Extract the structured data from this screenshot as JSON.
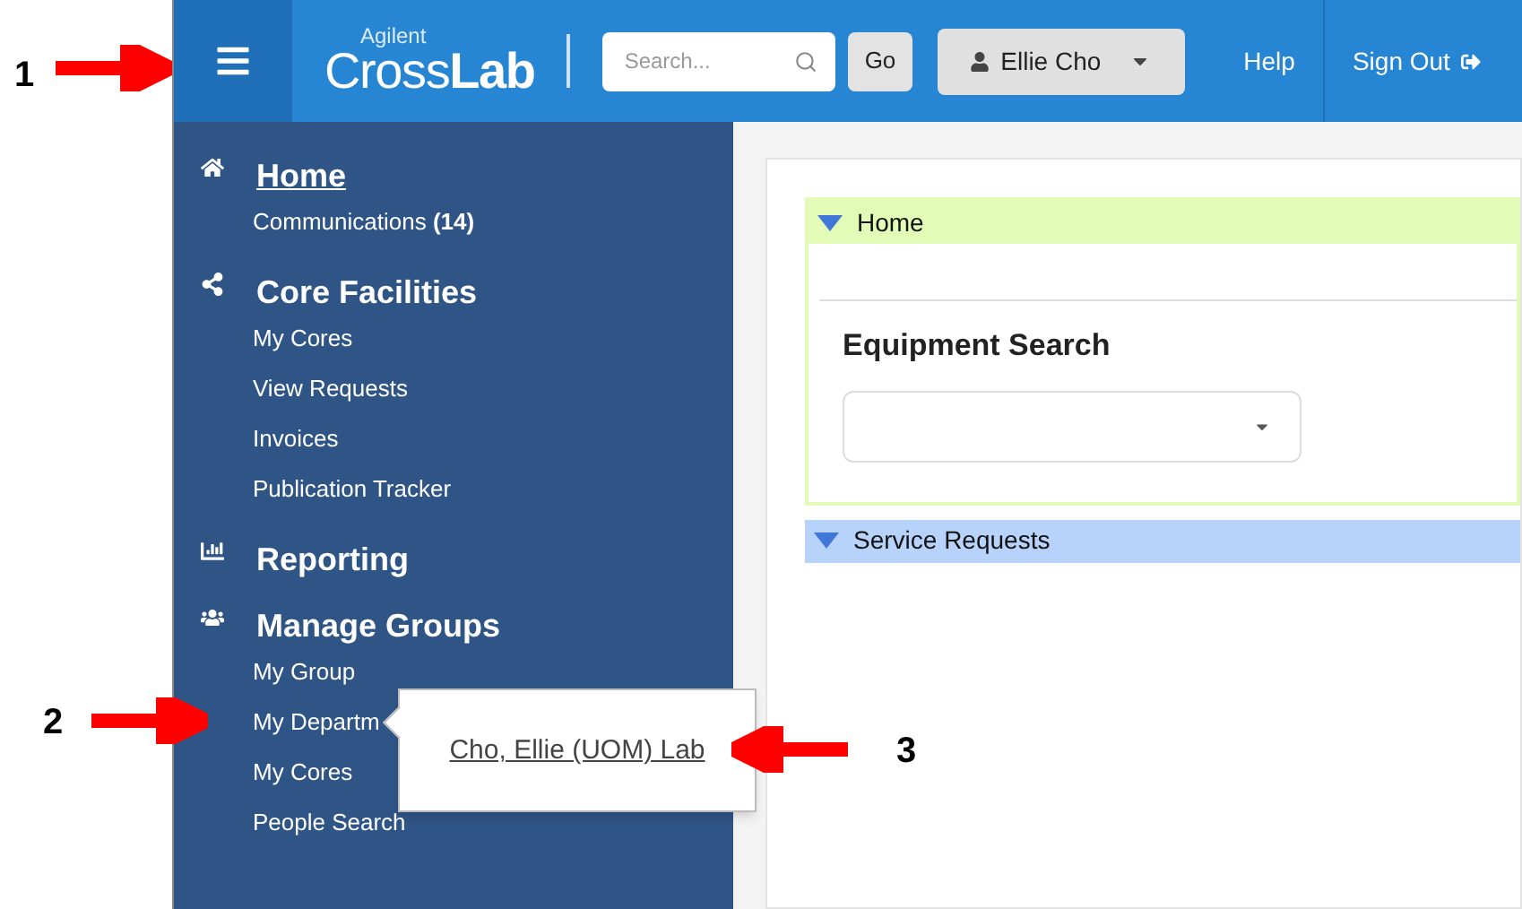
{
  "annotations": [
    {
      "label": "1"
    },
    {
      "label": "2"
    },
    {
      "label": "3"
    }
  ],
  "header": {
    "logo": {
      "small": "Agilent",
      "light": "Cross",
      "bold": "Lab"
    },
    "search": {
      "placeholder": "Search..."
    },
    "go_button": "Go",
    "user": "Ellie Cho",
    "links": [
      "Help",
      "Sign Out"
    ]
  },
  "sidebar": {
    "sections": [
      {
        "kind": "home",
        "title": "Home",
        "selected": true,
        "items": [
          "Communications **(14)**"
        ]
      },
      {
        "kind": "share",
        "title": "Core Facilities",
        "selected": false,
        "items": [
          "My Cores",
          "View Requests",
          "Invoices",
          "Publication Tracker"
        ]
      },
      {
        "kind": "chart",
        "title": "Reporting",
        "selected": false
      },
      {
        "kind": "users",
        "title": "Manage Groups",
        "selected": false,
        "items": [
          "My Group",
          "My Departm",
          "My Cores",
          "People Search"
        ]
      }
    ]
  },
  "popover": {
    "link": "Cho, Ellie (UOM) Lab"
  },
  "panels": [
    {
      "title": "Home",
      "expanded": true,
      "color": "#e2fcb8",
      "heading": "Equipment Search"
    },
    {
      "title": "Service Requests",
      "expanded": true,
      "color": "#b8d3fb"
    }
  ]
}
